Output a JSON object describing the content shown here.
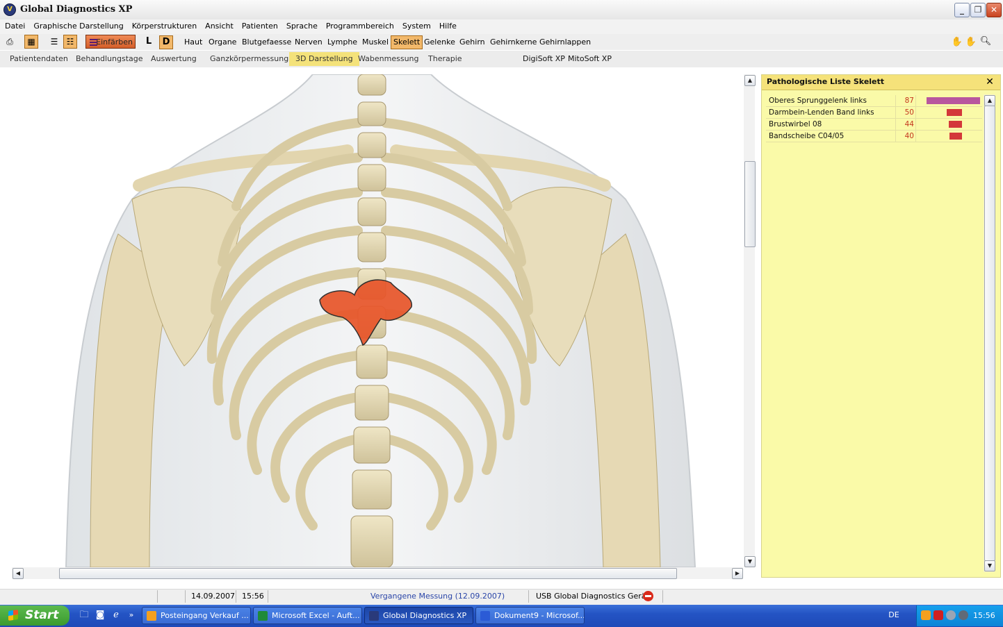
{
  "window": {
    "title": "Global Diagnostics XP"
  },
  "menu": [
    "Datei",
    "Graphische Darstellung",
    "Körperstrukturen",
    "Ansicht",
    "Patienten",
    "Sprache",
    "Programmbereich",
    "System",
    "Hilfe"
  ],
  "toolbar": {
    "einfaerben_label": "Einfärben",
    "l_label": "L",
    "d_label": "D",
    "layers": [
      "Haut",
      "Organe",
      "Blutgefaesse",
      "Nerven",
      "Lymphe",
      "Muskel",
      "Skelett",
      "Gelenke",
      "Gehirn",
      "Gehirnkerne",
      "Gehirnlappen"
    ],
    "selected_layer": "Skelett"
  },
  "tabs": [
    "Patientendaten",
    "Behandlungstage",
    "Auswertung",
    "Ganzkörpermessung",
    "3D Darstellung",
    "Wabenmessung",
    "Therapie"
  ],
  "active_tab": "3D Darstellung",
  "extra_links": [
    "DigiSoft XP",
    "MitoSoft XP"
  ],
  "panel": {
    "title": "Pathologische Liste Skelett",
    "items": [
      {
        "name": "Oberes Sprunggelenk links",
        "value": "87",
        "bar_fraction": 0.87,
        "color": "#b8579e"
      },
      {
        "name": "Darmbein-Lenden Band links",
        "value": "50",
        "bar_fraction": 0.25,
        "color": "#d3383a"
      },
      {
        "name": "Brustwirbel 08",
        "value": "44",
        "bar_fraction": 0.22,
        "color": "#d3383a"
      },
      {
        "name": "Bandscheibe C04/05",
        "value": "40",
        "bar_fraction": 0.2,
        "color": "#d3383a"
      }
    ]
  },
  "status": {
    "date": "14.09.2007",
    "time": "15:56",
    "measurement": "Vergangene Messung (12.09.2007)",
    "device": "USB Global Diagnostics Gerät"
  },
  "taskbar": {
    "start": "Start",
    "tasks": [
      {
        "label": "Posteingang Verkauf ...",
        "color": "#f4a020"
      },
      {
        "label": "Microsoft Excel - Auft...",
        "color": "#1f8a3a"
      },
      {
        "label": "Global Diagnostics XP",
        "color": "#2a3a7a"
      },
      {
        "label": "Dokument9 - Microsof...",
        "color": "#2b5bd6"
      }
    ],
    "language": "DE",
    "clock": "15:56"
  }
}
